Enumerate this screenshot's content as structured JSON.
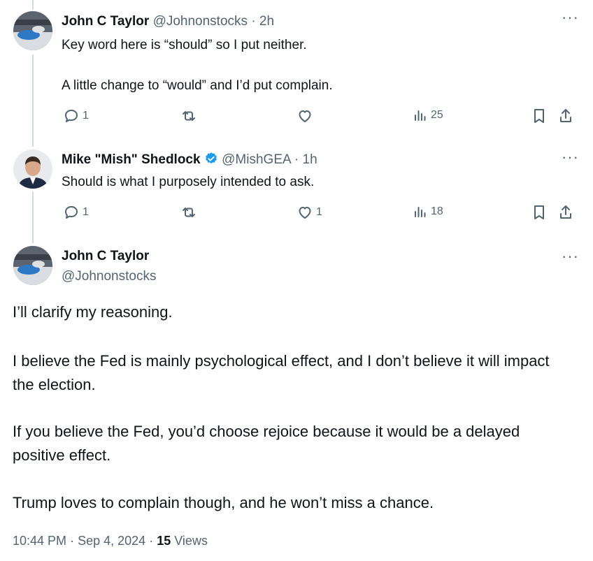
{
  "tweets": [
    {
      "name": "John C Taylor",
      "handle": "@Johnonstocks",
      "time": "2h",
      "lines": [
        "Key word here is “should” so I put neither.",
        "A little change to “would” and I’d put complain."
      ],
      "replies": "1",
      "retweets": "",
      "likes": "",
      "views": "25"
    },
    {
      "name": "Mike \"Mish\" Shedlock",
      "handle": "@MishGEA",
      "time": "1h",
      "verified": true,
      "lines": [
        "Should is what I purposely intended to ask."
      ],
      "replies": "1",
      "retweets": "",
      "likes": "1",
      "views": "18"
    }
  ],
  "main": {
    "name": "John C Taylor",
    "handle": "@Johnonstocks",
    "paragraphs": [
      "I’ll clarify my reasoning.",
      "I believe the Fed is mainly psychological effect, and I don’t believe it will impact the election.",
      "If you believe the Fed, you’d choose rejoice because it would be a delayed positive effect.",
      "Trump loves to complain though, and he won’t miss a chance."
    ],
    "time": "10:44 PM",
    "date": "Sep 4, 2024",
    "views_count": "15",
    "views_label": "Views"
  },
  "separator": "·",
  "colors": {
    "verified": "#1d9bf0",
    "muted": "#536471",
    "line": "#cfd9de"
  }
}
